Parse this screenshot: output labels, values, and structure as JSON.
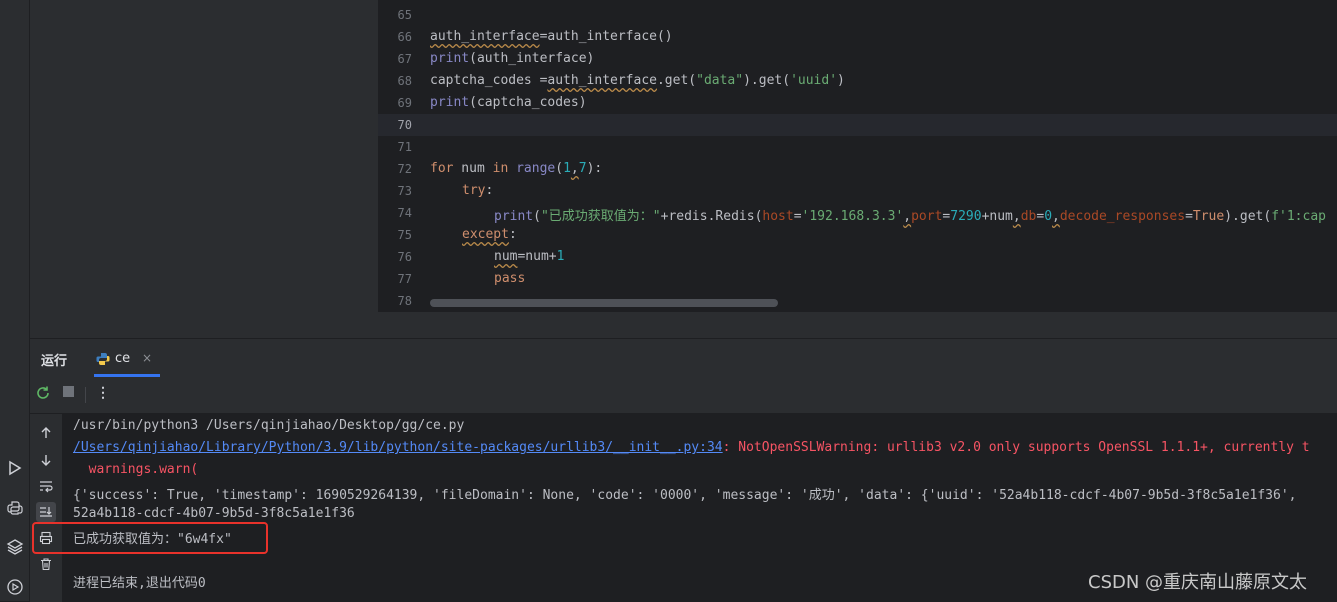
{
  "editor": {
    "current_line": "70",
    "lines": [
      {
        "n": "65"
      },
      {
        "n": "66"
      },
      {
        "n": "67"
      },
      {
        "n": "68"
      },
      {
        "n": "69"
      },
      {
        "n": "70"
      },
      {
        "n": "71"
      },
      {
        "n": "72"
      },
      {
        "n": "73"
      },
      {
        "n": "74"
      },
      {
        "n": "75"
      },
      {
        "n": "76"
      },
      {
        "n": "77"
      },
      {
        "n": "78"
      }
    ],
    "code": {
      "l66": [
        "auth_interface",
        "=",
        "auth_interface()"
      ],
      "l67": [
        "print",
        "(auth_interface)"
      ],
      "l68": [
        "captcha_codes =",
        "auth_interface",
        ".get(",
        "\"data\"",
        ").get(",
        "'uuid'",
        ")"
      ],
      "l69": [
        "print",
        "(captcha_codes)"
      ],
      "l72": [
        "for",
        " num ",
        "in",
        " ",
        "range",
        "(",
        "1",
        ",",
        "7",
        "):"
      ],
      "l73": [
        "try",
        ":"
      ],
      "l74": [
        "print",
        "(",
        "\"已成功获取值为：\"",
        "+redis.",
        "Redis",
        "(",
        "host",
        "=",
        "'192.168.3.3'",
        ",",
        "port",
        "=",
        "7290",
        "+num",
        ",",
        "db",
        "=",
        "0",
        ",",
        "decode_responses",
        "=",
        "True",
        ").get(",
        "f'1:cap"
      ],
      "l75": [
        "except",
        ":"
      ],
      "l76": [
        "num",
        "=num+",
        "1"
      ],
      "l77": [
        "pass"
      ]
    }
  },
  "run_window": {
    "title": "运行",
    "tab_label": "ce",
    "tab_close": "×"
  },
  "console": {
    "line1": "/usr/bin/python3 /Users/qinjiahao/Desktop/gg/ce.py",
    "line2_link": "/Users/qinjiahao/Library/Python/3.9/lib/python/site-packages/urllib3/__init__.py:34",
    "line2_rest": ": NotOpenSSLWarning: urllib3 v2.0 only supports OpenSSL 1.1.1+, currently t",
    "line3": "  warnings.warn(",
    "line4": "{'success': True, 'timestamp': 1690529264139, 'fileDomain': None, 'code': '0000', 'message': '成功', 'data': {'uuid': '52a4b118-cdcf-4b07-9b5d-3f8c5a1e1f36',",
    "line5": "52a4b118-cdcf-4b07-9b5d-3f8c5a1e1f36",
    "line6": "已成功获取值为：\"6w4fx\"",
    "line7": "进程已结束,退出代码0"
  },
  "watermark": "CSDN @重庆南山藤原文太",
  "colors": {
    "accent": "#3574f0",
    "highlight_box": "#e8322b"
  }
}
